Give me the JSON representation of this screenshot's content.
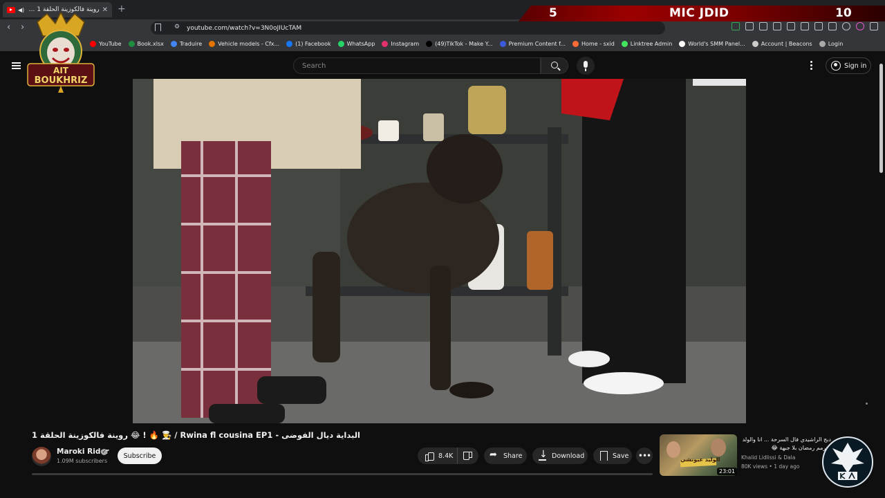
{
  "browser": {
    "tab_title": "روينة فالكوزينة الحلقة 1 😂 - البد",
    "url": "youtube.com/watch?v=3N0oJIUcTAM",
    "bookmarks": [
      {
        "label": "YouTube",
        "color": "#ff0000"
      },
      {
        "label": "Book.xlsx",
        "color": "#1e8e3e"
      },
      {
        "label": "Traduire",
        "color": "#4285f4"
      },
      {
        "label": "Vehicle models - Cfx...",
        "color": "#e37400"
      },
      {
        "label": "(1) Facebook",
        "color": "#1877f2"
      },
      {
        "label": "WhatsApp",
        "color": "#25d366"
      },
      {
        "label": "Instagram",
        "color": "#e1306c"
      },
      {
        "label": "(49)TikTok - Make Y...",
        "color": "#000000"
      },
      {
        "label": "Premium Content f...",
        "color": "#3b5bdb"
      },
      {
        "label": "Home - sxid",
        "color": "#ff6b35"
      },
      {
        "label": "Linktree Admin",
        "color": "#43e55e"
      },
      {
        "label": "World's SMM Panel...",
        "color": "#ffffff"
      },
      {
        "label": "Account | Beacons",
        "color": "#cccccc"
      },
      {
        "label": "Login",
        "color": "#aaaaaa"
      }
    ]
  },
  "overlay": {
    "score_left": "5",
    "title": "MIC JDID",
    "score_right": "10",
    "logo_line1": "AIT",
    "logo_line2": "BOUKHRIZ"
  },
  "header": {
    "search_placeholder": "Search",
    "signin_label": "Sign in"
  },
  "video": {
    "title": "روينة فالكوزينة الحلقة 1 😂 ! 🔥 👨‍🍳 / Rwina fl cousina EP1 - البداية ديال الفوضى",
    "channel": "Maroki Rider",
    "subscribers": "1.09M subscribers",
    "subscribe_label": "Subscribe",
    "likes": "8.4K",
    "share_label": "Share",
    "download_label": "Download",
    "save_label": "Save"
  },
  "recommendation": {
    "title": "دبج الراشيدي فال السرحة ... انا والولد عترمم رمضان بلا جبهة 😂",
    "thumb_text": "الوليد عيونشي",
    "duration": "23:01",
    "channel": "Khalid Lidlissi & Dala",
    "meta": "80K views • 1 day ago"
  },
  "colors": {
    "background": "#0f0f0f",
    "chrome": "#35363a",
    "tabstrip": "#202124",
    "overlay_red": "#9b0000"
  }
}
